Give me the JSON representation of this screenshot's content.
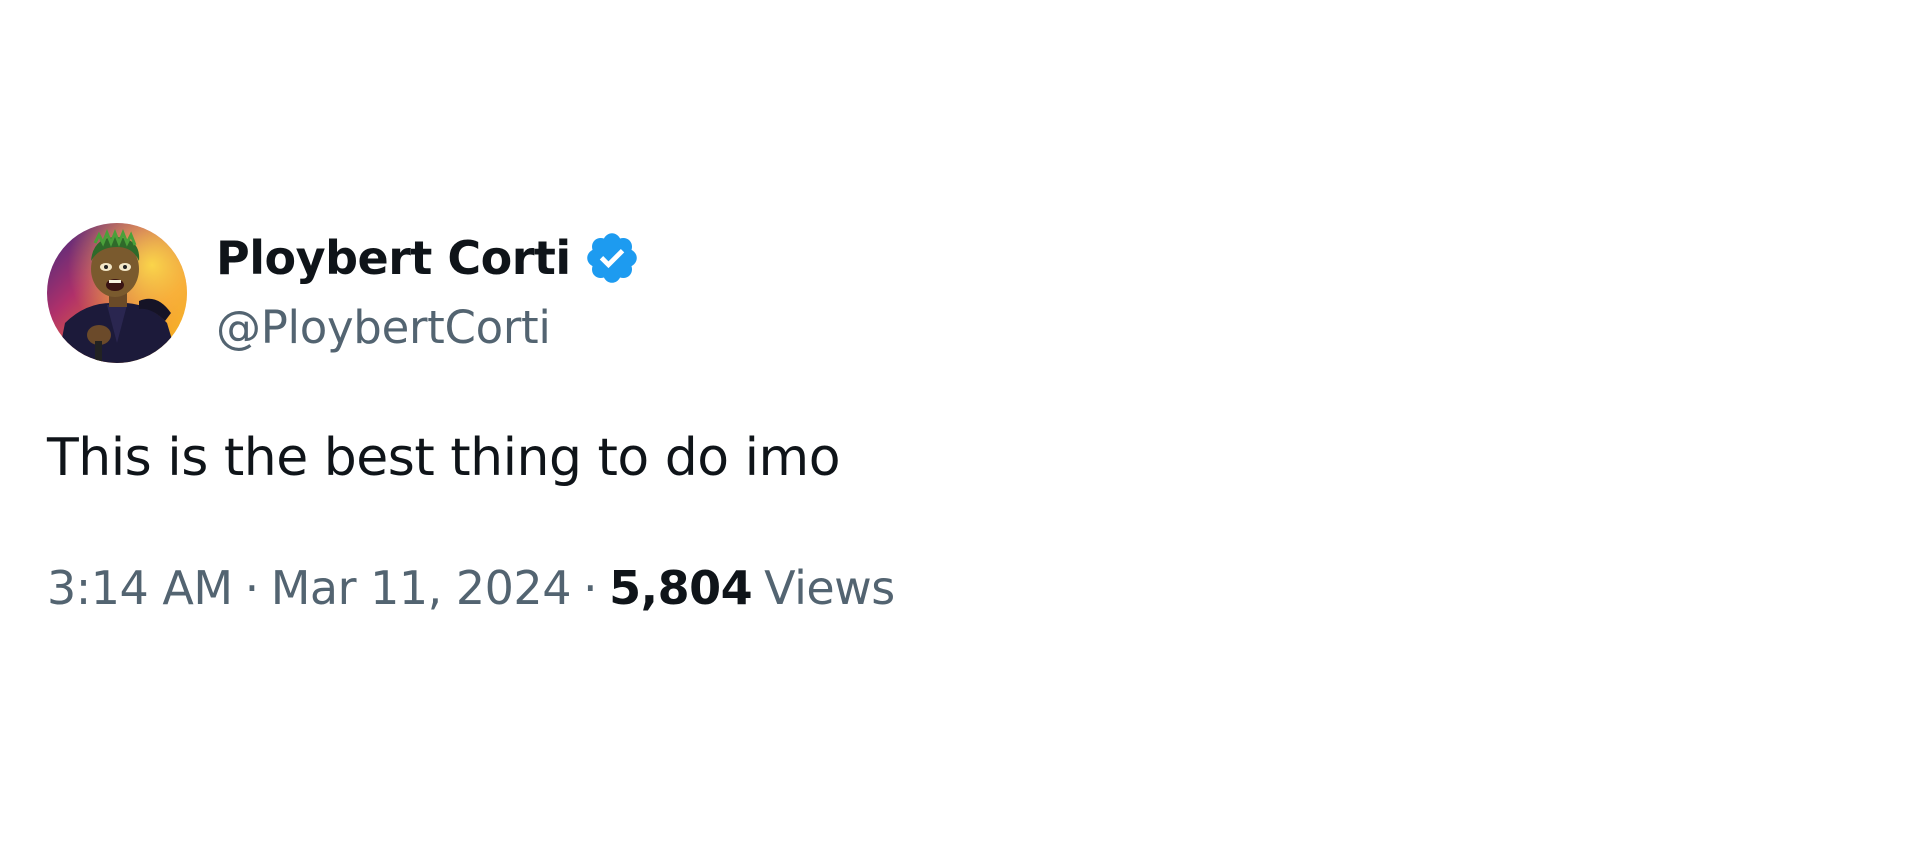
{
  "author": {
    "display_name": "Ploybert Corti",
    "handle": "@PloybertCorti",
    "verified": true,
    "verified_color": "#1d9bf0"
  },
  "tweet": {
    "text": "This is the best thing to do imo"
  },
  "meta": {
    "time": "3:14 AM",
    "separator": "·",
    "date": "Mar 11, 2024",
    "views_count": "5,804",
    "views_label": "Views"
  },
  "colors": {
    "text_primary": "#0f1419",
    "text_secondary": "#536471",
    "background": "#ffffff"
  },
  "icons": {
    "avatar": "profile-photo",
    "verified": "verified-badge-icon"
  }
}
